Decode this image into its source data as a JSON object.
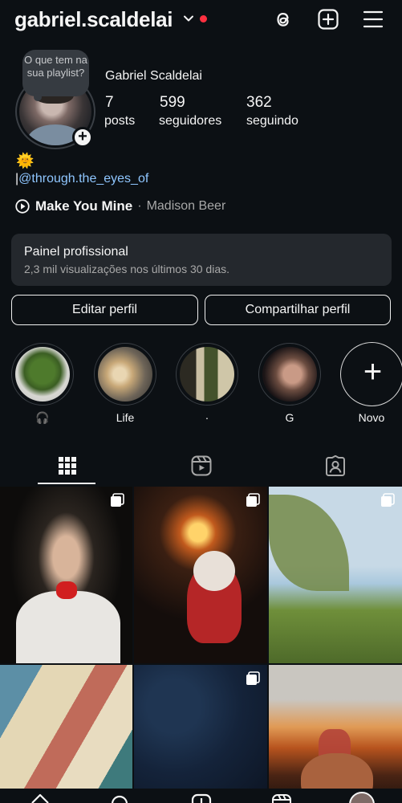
{
  "header": {
    "username": "gabriel.scaldelai",
    "icons": [
      "chevron-down-icon",
      "threads-icon",
      "new-post-icon",
      "menu-icon"
    ],
    "notification_color": "#ff3040"
  },
  "profile": {
    "note": "O que tem na sua playlist?",
    "full_name": "Gabriel Scaldelai",
    "stats": [
      {
        "value": "7",
        "label": "posts"
      },
      {
        "value": "599",
        "label": "seguidores"
      },
      {
        "value": "362",
        "label": "seguindo"
      }
    ],
    "bio_emoji": "🌞",
    "bio_bar": "|",
    "bio_handle": "@through.the_eyes_of",
    "music_title": "Make You Mine",
    "music_sep": "·",
    "music_artist": "Madison Beer"
  },
  "panel": {
    "title": "Painel profissional",
    "subtitle": "2,3 mil visualizações nos últimos 30 dias."
  },
  "buttons": {
    "edit": "Editar perfil",
    "share": "Compartilhar perfil"
  },
  "highlights": [
    {
      "label": "🎧"
    },
    {
      "label": "Life"
    },
    {
      "label": "·"
    },
    {
      "label": "G"
    },
    {
      "label": "Novo"
    }
  ],
  "tabs": [
    "grid-icon",
    "reels-icon",
    "tagged-icon"
  ],
  "colors": {
    "background": "#0c1014",
    "panel": "#24282d",
    "link": "#8fc6ff"
  }
}
